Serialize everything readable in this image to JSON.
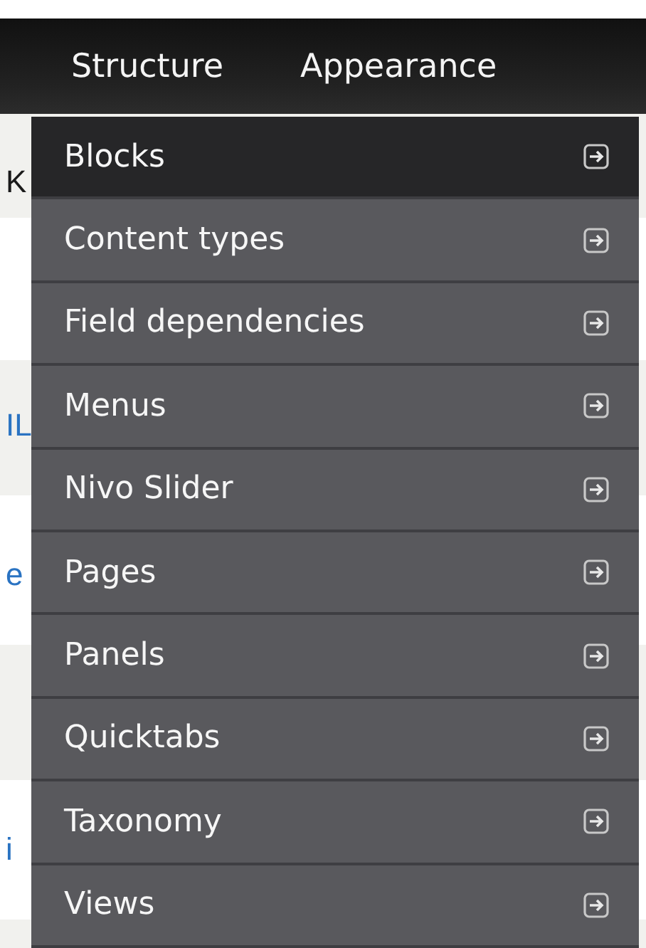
{
  "top_nav": [
    {
      "label": "Structure"
    },
    {
      "label": "Appearance"
    }
  ],
  "page_behind": [
    {
      "text": "K",
      "kind": "heading"
    },
    {
      "text": "IL",
      "kind": "link"
    },
    {
      "text": "e",
      "kind": "link"
    },
    {
      "text": "i",
      "kind": "link"
    }
  ],
  "dropdown": {
    "items": [
      {
        "label": "Blocks",
        "selected": true
      },
      {
        "label": "Content types",
        "selected": false
      },
      {
        "label": "Field dependencies",
        "selected": false
      },
      {
        "label": "Menus",
        "selected": false
      },
      {
        "label": "Nivo Slider",
        "selected": false
      },
      {
        "label": "Pages",
        "selected": false
      },
      {
        "label": "Panels",
        "selected": false
      },
      {
        "label": "Quicktabs",
        "selected": false
      },
      {
        "label": "Taxonomy",
        "selected": false
      },
      {
        "label": "Views",
        "selected": false
      }
    ]
  }
}
